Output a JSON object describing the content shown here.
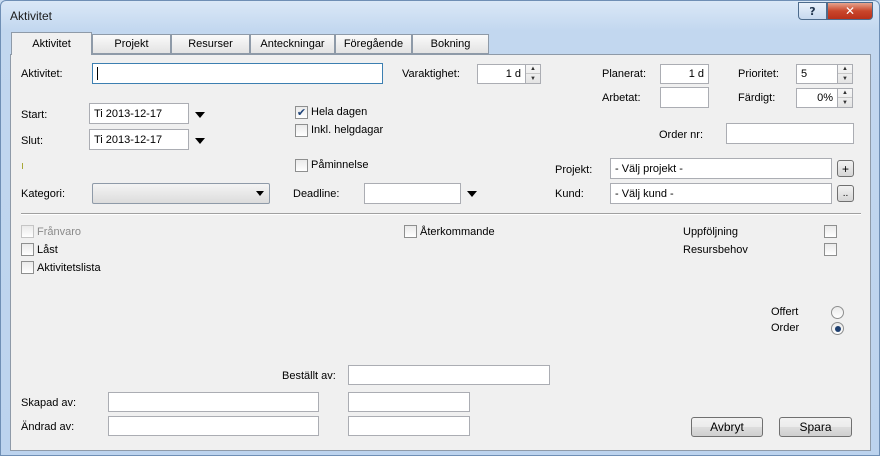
{
  "window": {
    "title": "Aktivitet",
    "help": "?",
    "close": "✕"
  },
  "tabs": [
    "Aktivitet",
    "Projekt",
    "Resurser",
    "Anteckningar",
    "Föregående",
    "Bokning"
  ],
  "labels": {
    "aktivitet": "Aktivitet:",
    "varaktighet": "Varaktighet:",
    "planerat": "Planerat:",
    "prioritet": "Prioritet:",
    "arbetat": "Arbetat:",
    "fardigt": "Färdigt:",
    "start": "Start:",
    "slut": "Slut:",
    "ordernr": "Order nr:",
    "projekt": "Projekt:",
    "kund": "Kund:",
    "kategori": "Kategori:",
    "deadline": "Deadline:",
    "bestallt": "Beställt av:",
    "skapad": "Skapad av:",
    "andrad": "Ändrad av:"
  },
  "values": {
    "aktivitet": "",
    "varaktighet": "1 d",
    "planerat": "1 d",
    "prioritet": "5",
    "arbetat": "",
    "fardigt": "0%",
    "start": "Ti 2013-12-17",
    "slut": "Ti 2013-12-17",
    "ordernr": "",
    "projekt": "- Välj projekt -",
    "kund": "- Välj kund -",
    "kategori": "",
    "deadline": ""
  },
  "checkboxes": {
    "hela_dagen": {
      "label": "Hela dagen",
      "checked": true
    },
    "inkl_helgdagar": {
      "label": "Inkl. helgdagar",
      "checked": false
    },
    "paminnelse": {
      "label": "Påminnelse",
      "checked": false
    },
    "franvaro": {
      "label": "Frånvaro",
      "checked": false
    },
    "last": {
      "label": "Låst",
      "checked": false
    },
    "aktivitetslista": {
      "label": "Aktivitetslista",
      "checked": false
    },
    "aterkommande": {
      "label": "Återkommande",
      "checked": false
    },
    "uppfoljning": {
      "label": "Uppföljning",
      "checked": false
    },
    "resursbehov": {
      "label": "Resursbehov",
      "checked": false
    }
  },
  "radios": {
    "offert": {
      "label": "Offert",
      "selected": false
    },
    "order": {
      "label": "Order",
      "selected": true
    }
  },
  "buttons": {
    "add_project": "+",
    "browse_customer": "..",
    "cancel": "Avbryt",
    "save": "Spara"
  },
  "icons": {
    "check": "✔",
    "spin_up": "▲",
    "spin_down": "▼"
  }
}
